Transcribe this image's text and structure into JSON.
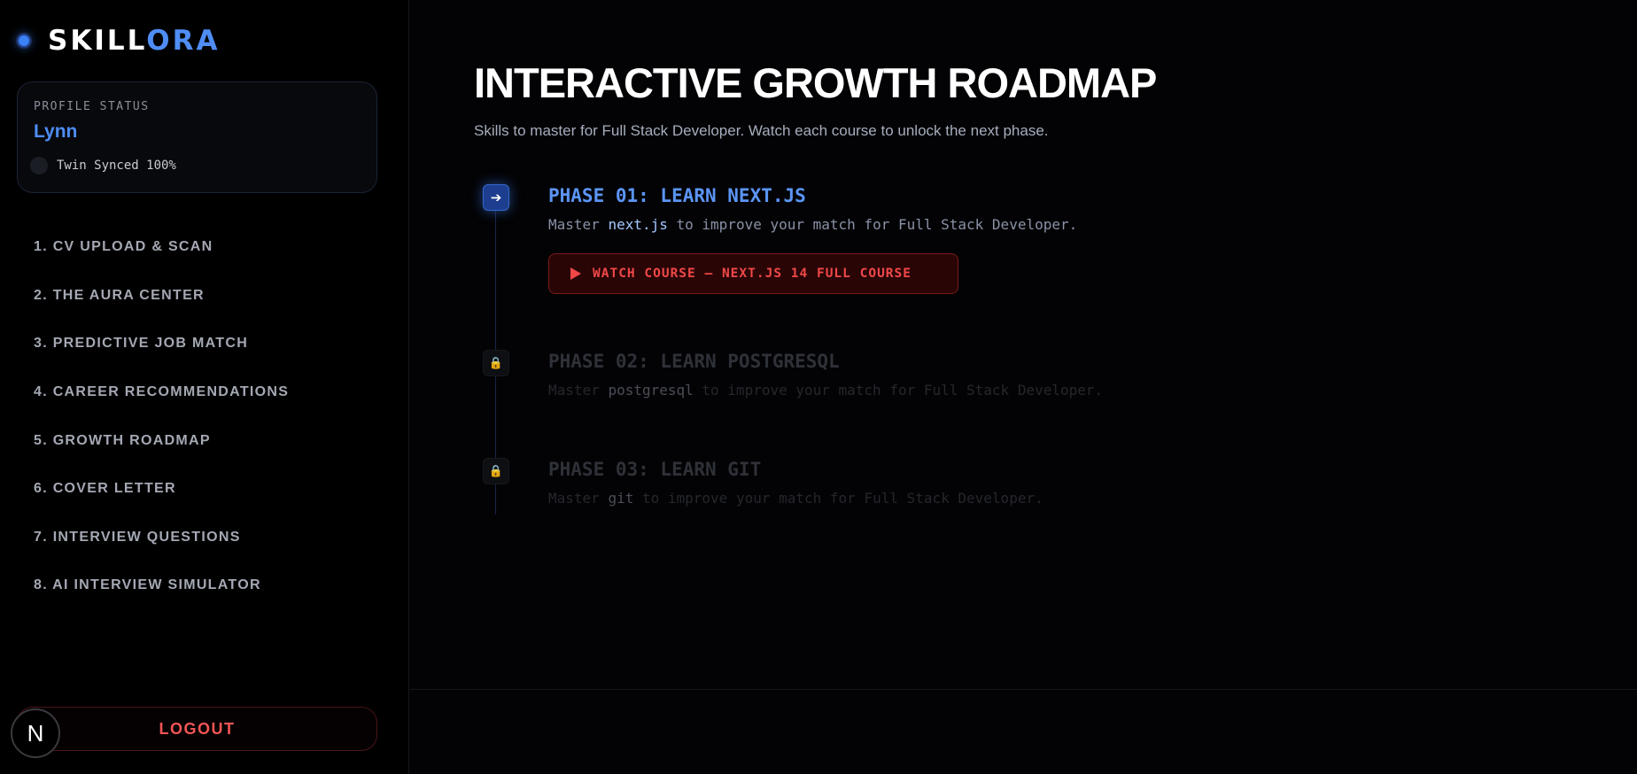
{
  "brand": {
    "name_part1": "SKILL",
    "name_part2": "ORA",
    "icon": "orb-icon",
    "accent_color": "#4f8df5"
  },
  "profile": {
    "label": "PROFILE STATUS",
    "name": "Lynn",
    "sync_status": "Twin Synced 100%"
  },
  "nav": {
    "items": [
      {
        "label": "1. CV UPLOAD & SCAN"
      },
      {
        "label": "2. THE AURA CENTER"
      },
      {
        "label": "3. PREDICTIVE JOB MATCH"
      },
      {
        "label": "4. CAREER RECOMMENDATIONS"
      },
      {
        "label": "5. GROWTH ROADMAP"
      },
      {
        "label": "6. COVER LETTER"
      },
      {
        "label": "7. INTERVIEW QUESTIONS"
      },
      {
        "label": "8. AI INTERVIEW SIMULATOR"
      }
    ]
  },
  "logout_label": "LOGOUT",
  "avatar_letter": "N",
  "main": {
    "title": "INTERACTIVE GROWTH ROADMAP",
    "subtitle": "Skills to master for Full Stack Developer. Watch each course to unlock the next phase."
  },
  "phases": [
    {
      "title": "PHASE 01: LEARN NEXT.JS",
      "desc_prefix": "Master ",
      "skill": "next.js",
      "desc_suffix": " to improve your match for Full Stack Developer.",
      "status": "active",
      "icon": "arrow-right-icon",
      "button_label": "WATCH COURSE — NEXT.JS 14 FULL COURSE"
    },
    {
      "title": "PHASE 02: LEARN POSTGRESQL",
      "desc_prefix": "Master ",
      "skill": "postgresql",
      "desc_suffix": " to improve your match for Full Stack Developer.",
      "status": "locked",
      "icon": "lock-icon"
    },
    {
      "title": "PHASE 03: LEARN GIT",
      "desc_prefix": "Master ",
      "skill": "git",
      "desc_suffix": " to improve your match for Full Stack Developer.",
      "status": "locked",
      "icon": "lock-icon"
    }
  ],
  "colors": {
    "background": "#030305",
    "accent_blue": "#4f8df5",
    "danger_red": "#f04848"
  }
}
